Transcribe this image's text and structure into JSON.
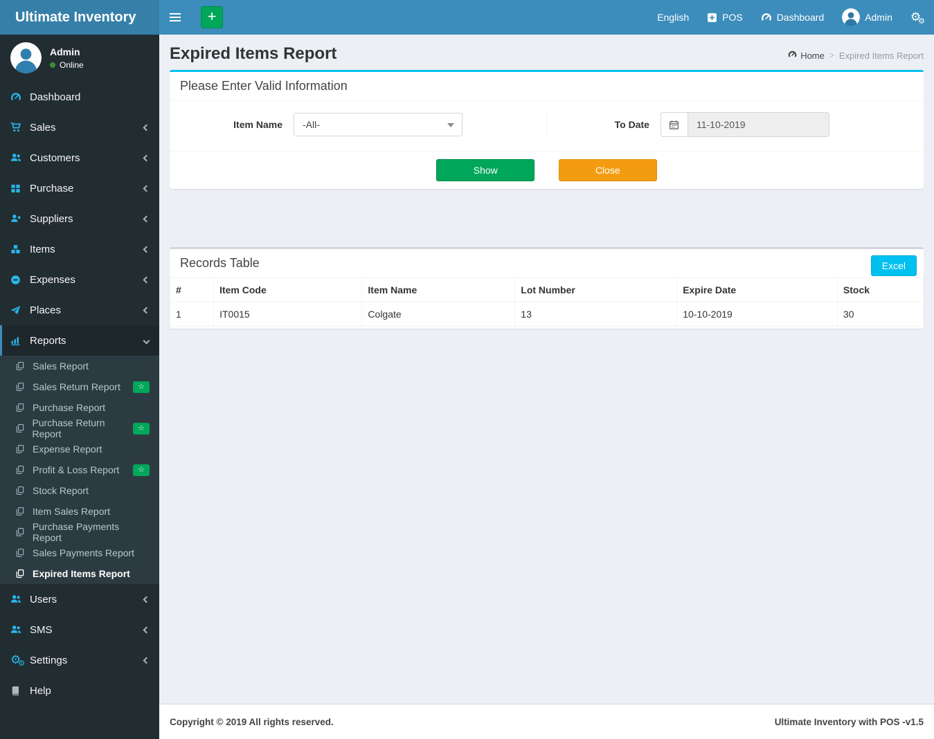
{
  "brand": {
    "title": "Ultimate Inventory"
  },
  "navbar": {
    "language": "English",
    "pos": "POS",
    "dashboard": "Dashboard",
    "user": "Admin"
  },
  "user_panel": {
    "name": "Admin",
    "status": "Online"
  },
  "sidebar": {
    "items": [
      {
        "label": "Dashboard",
        "icon": "tachometer-icon"
      },
      {
        "label": "Sales",
        "icon": "cart-icon"
      },
      {
        "label": "Customers",
        "icon": "users-icon"
      },
      {
        "label": "Purchase",
        "icon": "grid-icon"
      },
      {
        "label": "Suppliers",
        "icon": "user-plus-icon"
      },
      {
        "label": "Items",
        "icon": "cubes-icon"
      },
      {
        "label": "Expenses",
        "icon": "minus-circle-icon"
      },
      {
        "label": "Places",
        "icon": "paper-plane-icon"
      },
      {
        "label": "Reports",
        "icon": "bar-chart-icon",
        "active": true,
        "expanded": true
      },
      {
        "label": "Users",
        "icon": "users-icon"
      },
      {
        "label": "SMS",
        "icon": "users-icon"
      },
      {
        "label": "Settings",
        "icon": "cogs-icon"
      },
      {
        "label": "Help",
        "icon": "book-icon"
      }
    ],
    "reports_children": [
      {
        "label": "Sales Report",
        "badge": false
      },
      {
        "label": "Sales Return Report",
        "badge": true
      },
      {
        "label": "Purchase Report",
        "badge": false
      },
      {
        "label": "Purchase Return Report",
        "badge": true
      },
      {
        "label": "Expense Report",
        "badge": false
      },
      {
        "label": "Profit & Loss Report",
        "badge": true
      },
      {
        "label": "Stock Report",
        "badge": false
      },
      {
        "label": "Item Sales Report",
        "badge": false
      },
      {
        "label": "Purchase Payments Report",
        "badge": false
      },
      {
        "label": "Sales Payments Report",
        "badge": false
      },
      {
        "label": "Expired Items Report",
        "badge": false,
        "active": true
      }
    ]
  },
  "page": {
    "title": "Expired Items Report",
    "breadcrumb": {
      "home": "Home",
      "current": "Expired Items Report"
    }
  },
  "filter_panel": {
    "header": "Please Enter Valid Information",
    "item_name_label": "Item Name",
    "item_name_value": "-All-",
    "to_date_label": "To Date",
    "to_date_value": "11-10-2019",
    "show_button": "Show",
    "close_button": "Close"
  },
  "records": {
    "header": "Records Table",
    "excel_button": "Excel",
    "columns": [
      "#",
      "Item Code",
      "Item Name",
      "Lot Number",
      "Expire Date",
      "Stock"
    ],
    "rows": [
      {
        "num": "1",
        "item_code": "IT0015",
        "item_name": "Colgate",
        "lot_number": "13",
        "expire_date": "10-10-2019",
        "stock": "30"
      }
    ]
  },
  "footer": {
    "left": "Copyright © 2019 All rights reserved.",
    "right": "Ultimate Inventory with POS -v1.5"
  },
  "colors": {
    "navbar": "#3c8dbc",
    "logo_bg": "#367fa9",
    "sidebar": "#222d32",
    "submenu": "#2c3b41",
    "sidebar_icon": "#29b7ea",
    "green": "#00a65a",
    "orange": "#f39c12",
    "info": "#00c0ef",
    "content_bg": "#ecf0f5"
  }
}
